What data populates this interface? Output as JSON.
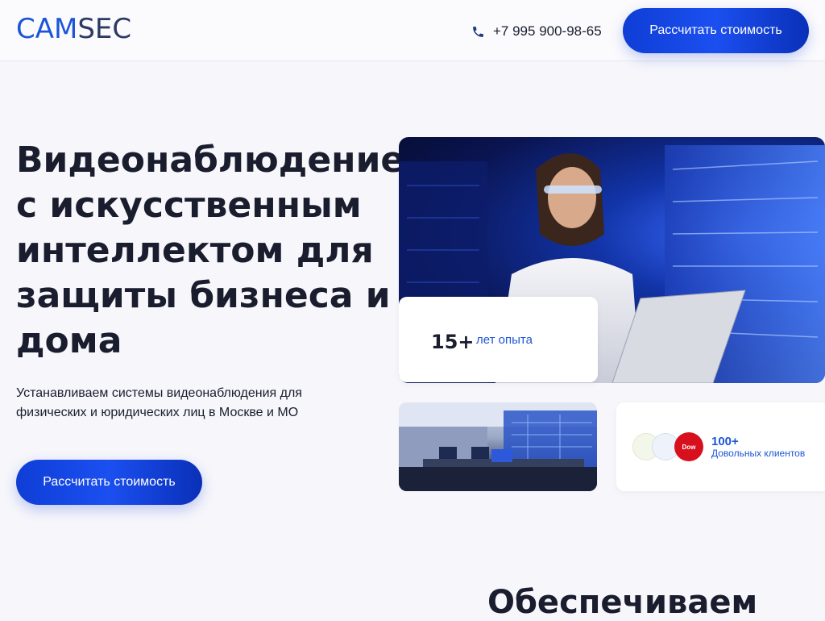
{
  "header": {
    "logo_part1": "CAM",
    "logo_part2": "SEC",
    "phone": "+7 995 900-98-65",
    "cta_label": "Рассчитать стоимость"
  },
  "hero": {
    "title": "Видеонаблюдение с искусственным интеллектом для защиты бизнеса и дома",
    "subtitle": "Устанавливаем системы видеонаблюдения для физических и юридических лиц в Москве и МО",
    "cta_label": "Рассчитать стоимость"
  },
  "stats": {
    "experience_value": "15+",
    "experience_label": "лет опыта",
    "clients_value": "100+",
    "clients_label": "Довольных клиентов",
    "client_logo_3": "Dow"
  },
  "next_section": {
    "title": "Обеспечиваем"
  },
  "colors": {
    "brand_blue": "#1c56d6",
    "button_gradient_start": "#0f3ed6",
    "button_gradient_end": "#0930b8",
    "text_dark": "#1a1d2e"
  },
  "icons": {
    "phone": "phone-icon"
  }
}
